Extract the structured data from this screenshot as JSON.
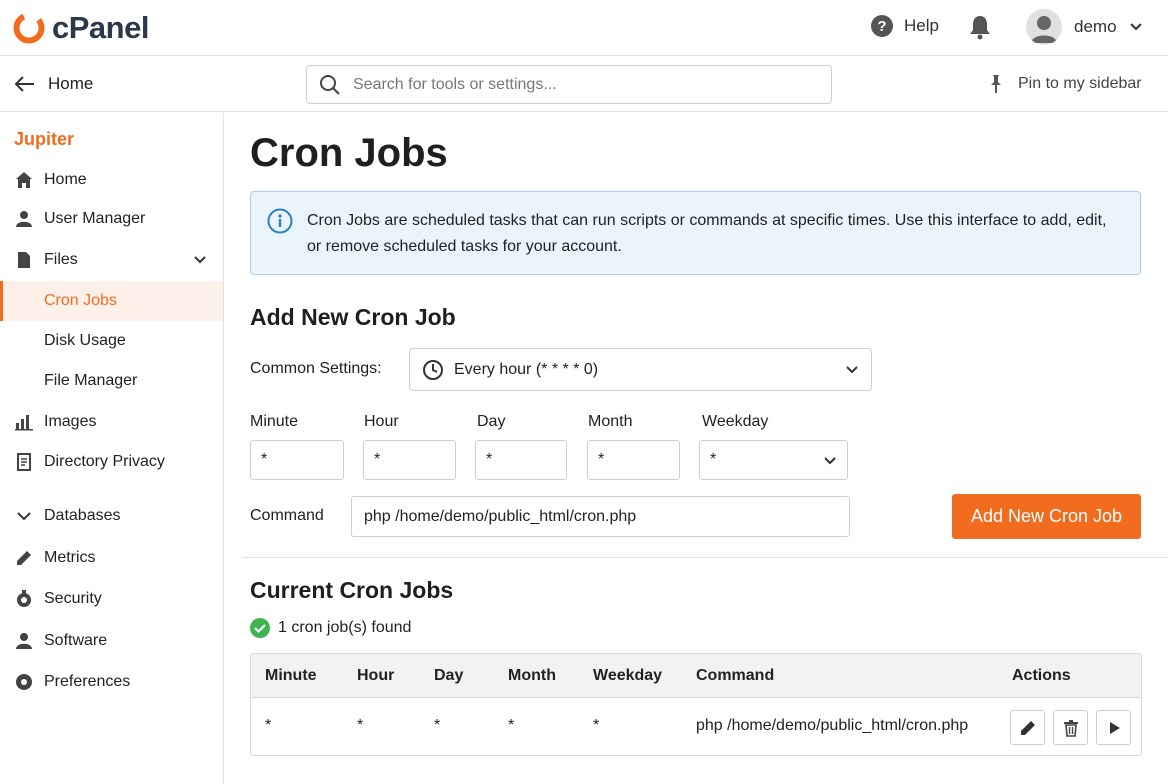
{
  "app": {
    "name": "cPanel",
    "brand_color": "#f26c1f"
  },
  "topbar": {
    "help_label": "Help",
    "user_name": "demo"
  },
  "subbar": {
    "back_label": "Home",
    "search_placeholder": "Search for tools or settings...",
    "pin_label": "Pin to my sidebar"
  },
  "sidebar": {
    "theme": "Jupiter",
    "items": [
      {
        "label": "Home",
        "icon": "home-icon"
      },
      {
        "label": "User Manager",
        "icon": "user-icon"
      },
      {
        "label": "Files",
        "icon": "file-icon"
      },
      {
        "label": "Cron Jobs",
        "icon": "",
        "active": true
      },
      {
        "label": "Disk Usage",
        "icon": ""
      },
      {
        "label": "File Manager",
        "icon": ""
      },
      {
        "label": "Images",
        "icon": "bar-chart-icon"
      },
      {
        "label": "Directory Privacy",
        "icon": "document-icon"
      },
      {
        "label": "Databases",
        "icon": "chevron-down-icon"
      },
      {
        "label": "Metrics",
        "icon": "pen-icon"
      },
      {
        "label": "Security",
        "icon": "shield-icon"
      },
      {
        "label": "Software",
        "icon": "user-icon"
      },
      {
        "label": "Preferences",
        "icon": "gear-icon"
      }
    ]
  },
  "main": {
    "title": "Cron Jobs",
    "info_text": "Cron Jobs are scheduled tasks that can run scripts or commands at specific times. Use this interface to add, edit, or remove scheduled tasks for your account.",
    "add_section": {
      "heading": "Add New Cron Job",
      "common_label": "Common Settings:",
      "common_value": "Every hour (* * * * 0)",
      "field_labels": {
        "minute": "Minute",
        "hour": "Hour",
        "day": "Day",
        "month": "Month",
        "weekday": "Weekday"
      },
      "field_values": {
        "minute": "*",
        "hour": "*",
        "day": "*",
        "month": "*",
        "weekday": "*"
      },
      "command_label": "Command",
      "command_value": "php /home/demo/public_html/cron.php",
      "add_button": "Add New Cron Job"
    },
    "current_section": {
      "heading": "Current Cron Jobs",
      "found_text": "1 cron job(s) found",
      "columns": [
        "Minute",
        "Hour",
        "Day",
        "Month",
        "Weekday",
        "Command",
        "Actions"
      ],
      "rows": [
        {
          "minute": "*",
          "hour": "*",
          "day": "*",
          "month": "*",
          "weekday": "*",
          "command": "php /home/demo/public_html/cron.php"
        }
      ]
    }
  }
}
